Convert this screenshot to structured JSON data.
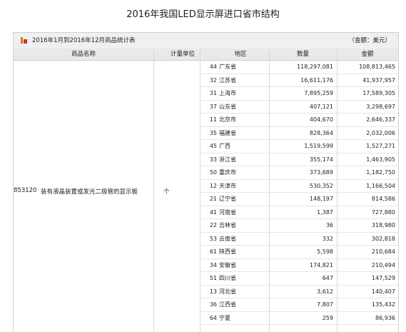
{
  "title": "2016年我国LED显示屏进口省市结构",
  "table": {
    "range_label": "2016年1月到2016年12月商品统计表",
    "currency_note": "（金额：美元）",
    "headers": {
      "name": "商品名称",
      "unit": "计量单位",
      "region": "地区",
      "quantity": "数量",
      "amount": "金额"
    },
    "product": {
      "hs_code": "853120",
      "name": "装有液晶装置或发光二极管的显示板",
      "unit": "个"
    },
    "rows": [
      {
        "code": "44",
        "region": "广东省",
        "quantity": "118,297,081",
        "amount": "108,813,465"
      },
      {
        "code": "32",
        "region": "江苏省",
        "quantity": "16,611,176",
        "amount": "41,937,957"
      },
      {
        "code": "31",
        "region": "上海市",
        "quantity": "7,895,259",
        "amount": "17,589,305"
      },
      {
        "code": "37",
        "region": "山东省",
        "quantity": "407,121",
        "amount": "3,298,697"
      },
      {
        "code": "11",
        "region": "北京市",
        "quantity": "404,670",
        "amount": "2,646,337"
      },
      {
        "code": "35",
        "region": "福建省",
        "quantity": "828,364",
        "amount": "2,032,006"
      },
      {
        "code": "45",
        "region": "广西",
        "quantity": "1,519,599",
        "amount": "1,527,271"
      },
      {
        "code": "33",
        "region": "浙江省",
        "quantity": "355,174",
        "amount": "1,463,905"
      },
      {
        "code": "50",
        "region": "重庆市",
        "quantity": "373,689",
        "amount": "1,182,750"
      },
      {
        "code": "12",
        "region": "天津市",
        "quantity": "530,352",
        "amount": "1,166,504"
      },
      {
        "code": "21",
        "region": "辽宁省",
        "quantity": "148,197",
        "amount": "814,586"
      },
      {
        "code": "41",
        "region": "河南省",
        "quantity": "1,387",
        "amount": "727,880"
      },
      {
        "code": "22",
        "region": "吉林省",
        "quantity": "36",
        "amount": "318,980"
      },
      {
        "code": "53",
        "region": "云南省",
        "quantity": "332",
        "amount": "302,818"
      },
      {
        "code": "61",
        "region": "陕西省",
        "quantity": "5,598",
        "amount": "210,684"
      },
      {
        "code": "34",
        "region": "安徽省",
        "quantity": "174,821",
        "amount": "210,494"
      },
      {
        "code": "51",
        "region": "四川省",
        "quantity": "647",
        "amount": "147,529"
      },
      {
        "code": "13",
        "region": "河北省",
        "quantity": "3,612",
        "amount": "140,407"
      },
      {
        "code": "36",
        "region": "江西省",
        "quantity": "7,807",
        "amount": "135,432"
      },
      {
        "code": "64",
        "region": "宁夏",
        "quantity": "259",
        "amount": "86,936"
      }
    ]
  },
  "colors": {
    "logo_orange": "#e8701a",
    "logo_red": "#c0392b"
  }
}
